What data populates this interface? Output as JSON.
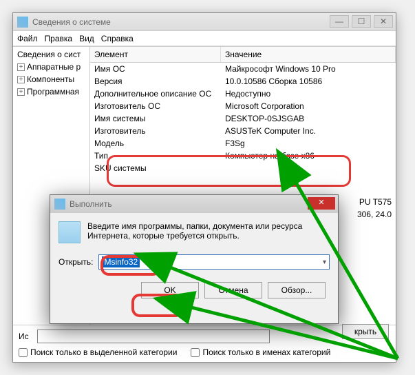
{
  "main_window": {
    "title": "Сведения о системе",
    "menu": {
      "file": "Файл",
      "edit": "Правка",
      "view": "Вид",
      "help": "Справка"
    },
    "win_controls": {
      "min": "—",
      "max": "☐",
      "close": "✕"
    }
  },
  "tree": {
    "root": "Сведения о сист",
    "items": [
      "Аппаратные р",
      "Компоненты",
      "Программная"
    ]
  },
  "grid": {
    "header_element": "Элемент",
    "header_value": "Значение",
    "rows": [
      {
        "el": "Имя ОС",
        "val": "Майкрософт Windows 10 Pro"
      },
      {
        "el": "Версия",
        "val": "10.0.10586 Сборка 10586"
      },
      {
        "el": "Дополнительное описание ОС",
        "val": "Недоступно"
      },
      {
        "el": "Изготовитель ОС",
        "val": "Microsoft Corporation"
      },
      {
        "el": "Имя системы",
        "val": "DESKTOP-0SJSGAB"
      },
      {
        "el": "Изготовитель",
        "val": "ASUSTeK Computer Inc."
      },
      {
        "el": "Модель",
        "val": "F3Sg"
      },
      {
        "el": "Тип",
        "val": "Компьютер на базе x86"
      },
      {
        "el": "SKU системы",
        "val": ""
      }
    ],
    "partial_right_1": "PU   T575",
    "partial_right_2": "306, 24.0"
  },
  "search": {
    "label": "Ис",
    "btn_close": "крыть",
    "chk1": "Поиск только в выделенной категории",
    "chk2": "Поиск только в именах категорий"
  },
  "run_dialog": {
    "title": "Выполнить",
    "prompt_text": "Введите имя программы, папки, документа или ресурса Интернета, которые требуется открыть.",
    "open_label": "Открыть:",
    "input_value": "Msinfo32",
    "btn_ok": "OK",
    "btn_cancel": "Отмена",
    "btn_browse": "Обзор...",
    "close_x": "✕"
  },
  "highlight_colors": {
    "red": "#e53935",
    "green": "#00a000"
  }
}
